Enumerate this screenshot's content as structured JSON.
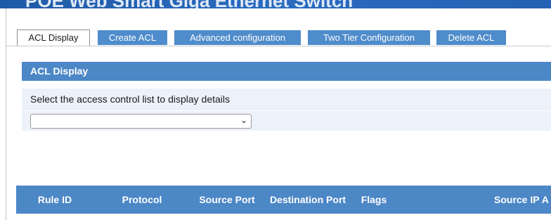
{
  "banner": {
    "title": "POE Web Smart Giga Ethernet Switch"
  },
  "tabs": [
    {
      "label": "ACL Display",
      "active": true
    },
    {
      "label": "Create ACL",
      "active": false
    },
    {
      "label": "Advanced configuration",
      "active": false
    },
    {
      "label": "Two Tier Configuration",
      "active": false
    },
    {
      "label": "Delete ACL",
      "active": false
    }
  ],
  "section": {
    "title": "ACL Display"
  },
  "selector": {
    "label": "Select the access control list to display details",
    "value": ""
  },
  "table": {
    "columns": [
      "Rule ID",
      "Protocol",
      "Source Port",
      "Destination Port",
      "Flags",
      "Source IP A"
    ]
  },
  "colors": {
    "accent": "#4c87c6",
    "tab_inactive": "#4f8ccb",
    "row_bg": "#edf1fa"
  }
}
